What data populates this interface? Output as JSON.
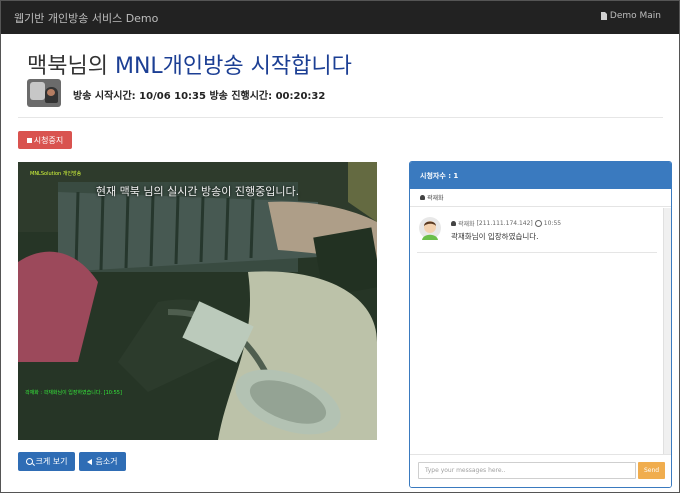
{
  "navbar": {
    "brand": "웹기반 개인방송 서비스 Demo",
    "right_link": "Demo Main"
  },
  "header": {
    "title_prefix": "맥북님의 ",
    "title_highlight": "MNL개인방송 시작합니다",
    "time_info": "방송 시작시간: 10/06 10:35  방송 진행시간: 00:20:32"
  },
  "controls": {
    "stop_label": "시청중지",
    "zoom_label": "크게 보기",
    "mute_label": "음소거"
  },
  "video": {
    "tag": "MNLSolution 개인방송",
    "overlay": "현재 맥북 님의 실시간 방송이 진행중입니다.",
    "log": "곽재화 : 곽재화님이 입장하였습니다. [10:55]"
  },
  "chat": {
    "header": "시청자수 : 1",
    "viewers": [
      "곽재화"
    ],
    "messages": [
      {
        "user": "곽재화",
        "ip": "[211.111.174.142]",
        "time": "10:55",
        "text": "곽재화님이 입장하였습니다."
      }
    ],
    "input_placeholder": "Type your messages here..",
    "send_label": "Send"
  },
  "colors": {
    "navbar": "#222222",
    "title_highlight": "#1c3f94",
    "danger": "#d9534f",
    "primary": "#2f6db5",
    "panel": "#3a7abf",
    "warning": "#f0ad4e"
  },
  "icons": [
    "document-icon",
    "user-icon",
    "stop-icon",
    "search-icon",
    "volume-icon",
    "clock-icon"
  ]
}
